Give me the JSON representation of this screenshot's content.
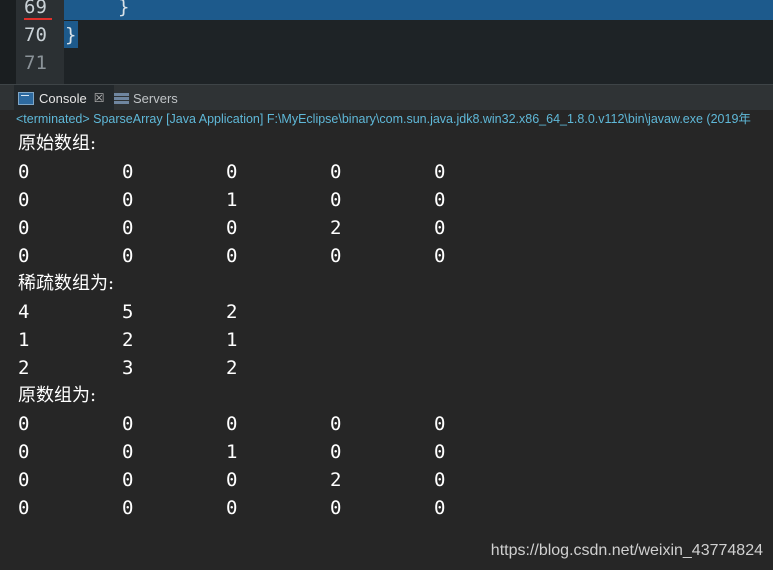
{
  "editor": {
    "lines": [
      {
        "num": "69",
        "code": "}"
      },
      {
        "num": "70",
        "code": "}"
      },
      {
        "num": "71",
        "code": ""
      }
    ]
  },
  "console": {
    "tabs": [
      {
        "label": "Console",
        "close": "☒"
      },
      {
        "label": "Servers"
      }
    ],
    "status": "<terminated> SparseArray [Java Application] F:\\MyEclipse\\binary\\com.sun.java.jdk8.win32.x86_64_1.8.0.v112\\bin\\javaw.exe (2019年",
    "sections": [
      {
        "heading": "原始数组:",
        "rows": [
          [
            "0",
            "0",
            "0",
            "0",
            "0"
          ],
          [
            "0",
            "0",
            "1",
            "0",
            "0"
          ],
          [
            "0",
            "0",
            "0",
            "2",
            "0"
          ],
          [
            "0",
            "0",
            "0",
            "0",
            "0"
          ]
        ]
      },
      {
        "heading": "稀疏数组为:",
        "rows": [
          [
            "4",
            "5",
            "2"
          ],
          [
            "1",
            "2",
            "1"
          ],
          [
            "2",
            "3",
            "2"
          ]
        ]
      },
      {
        "heading": "原数组为:",
        "rows": [
          [
            "0",
            "0",
            "0",
            "0",
            "0"
          ],
          [
            "0",
            "0",
            "1",
            "0",
            "0"
          ],
          [
            "0",
            "0",
            "0",
            "2",
            "0"
          ],
          [
            "0",
            "0",
            "0",
            "0",
            "0"
          ]
        ]
      }
    ]
  },
  "watermark": "https://blog.csdn.net/weixin_43774824"
}
